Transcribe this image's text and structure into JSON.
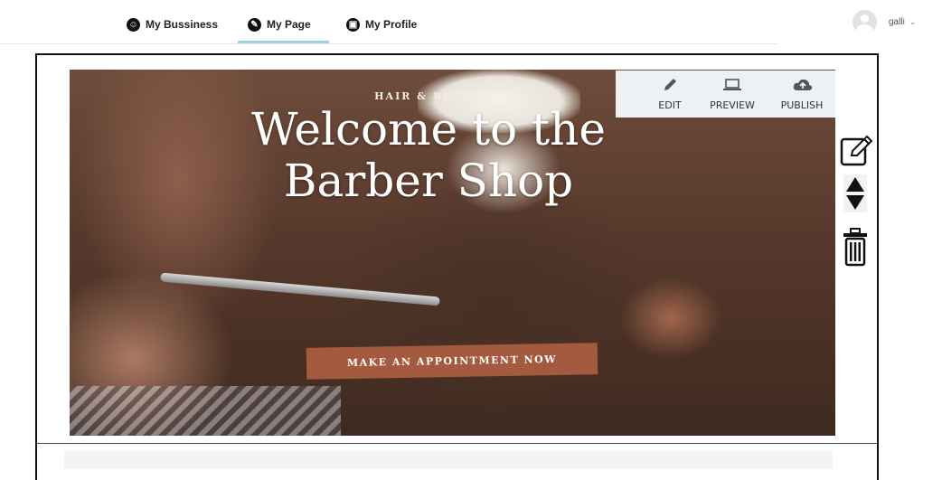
{
  "nav": {
    "tabs": [
      {
        "label": "My Bussiness",
        "icon": "business-icon"
      },
      {
        "label": "My Page",
        "icon": "edit-icon"
      },
      {
        "label": "My Profile",
        "icon": "profile-icon"
      }
    ],
    "active_tab": "My Page",
    "user": {
      "name": "galli",
      "icon": "avatar-icon",
      "menu_icon": "chevron-down-icon"
    }
  },
  "hero": {
    "kicker": "HAIR & BEARD",
    "title_line1": "Welcome to the",
    "title_line2": "Barber Shop",
    "cta_label": "MAKE AN APPOINTMENT NOW"
  },
  "toolbar": {
    "edit_label": "EDIT",
    "preview_label": "PREVIEW",
    "publish_label": "PUBLISH"
  },
  "side_tools": [
    "edit-section-icon",
    "move-up-icon",
    "move-down-icon",
    "delete-icon"
  ],
  "colors": {
    "cta_background": "#a45a3e",
    "active_tab_underline": "#9fd0dc",
    "toolbar_background": "#eef1f3"
  }
}
